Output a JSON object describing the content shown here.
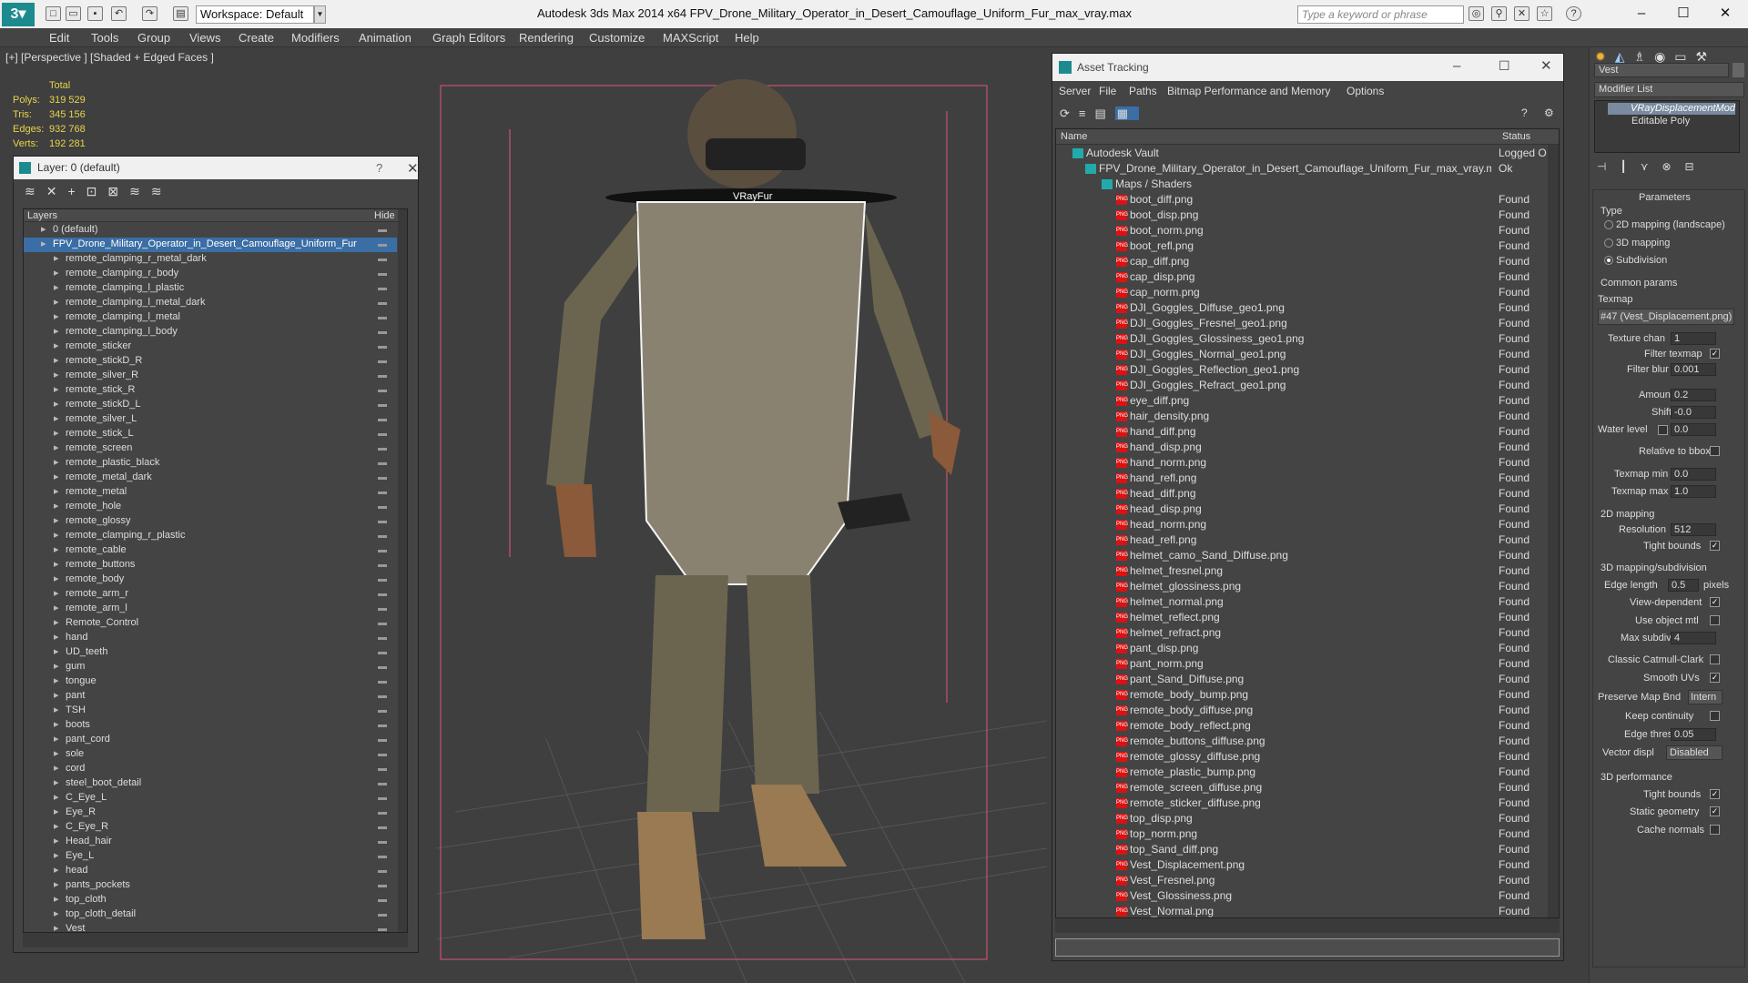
{
  "titlebar": {
    "workspace": "Workspace: Default",
    "title": "Autodesk 3ds Max  2014 x64      FPV_Drone_Military_Operator_in_Desert_Camouflage_Uniform_Fur_max_vray.max",
    "search_placeholder": "Type a keyword or phrase",
    "win_min": "–",
    "win_max": "☐",
    "win_close": "✕"
  },
  "menu": [
    "Edit",
    "Tools",
    "Group",
    "Views",
    "Create",
    "Modifiers",
    "Animation",
    "Graph Editors",
    "Rendering",
    "Customize",
    "MAXScript",
    "Help"
  ],
  "viewport": {
    "label": "[+] [Perspective ] [Shaded + Edged Faces ]",
    "stats": {
      "total": "Total",
      "polys_l": "Polys:",
      "polys": "319 529",
      "tris_l": "Tris:",
      "tris": "345 156",
      "edges_l": "Edges:",
      "edges": "932 768",
      "verts_l": "Verts:",
      "verts": "192 281"
    },
    "fur_label": "VRayFur",
    "accent": "#e05577"
  },
  "layer": {
    "title": "Layer: 0 (default)",
    "help": "?",
    "close": "✕",
    "col_layers": "Layers",
    "col_hide": "Hide",
    "default_layer": "0 (default)",
    "file_layer": "FPV_Drone_Military_Operator_in_Desert_Camouflage_Uniform_Fur",
    "items": [
      "remote_clamping_r_metal_dark",
      "remote_clamping_r_body",
      "remote_clamping_l_plastic",
      "remote_clamping_l_metal_dark",
      "remote_clamping_l_metal",
      "remote_clamping_l_body",
      "remote_sticker",
      "remote_stickD_R",
      "remote_silver_R",
      "remote_stick_R",
      "remote_stickD_L",
      "remote_silver_L",
      "remote_stick_L",
      "remote_screen",
      "remote_plastic_black",
      "remote_metal_dark",
      "remote_metal",
      "remote_hole",
      "remote_glossy",
      "remote_clamping_r_plastic",
      "remote_cable",
      "remote_buttons",
      "remote_body",
      "remote_arm_r",
      "remote_arm_l",
      "Remote_Control",
      "hand",
      "UD_teeth",
      "gum",
      "tongue",
      "pant",
      "TSH",
      "boots",
      "pant_cord",
      "sole",
      "cord",
      "steel_boot_detail",
      "C_Eye_L",
      "Eye_R",
      "C_Eye_R",
      "Head_hair",
      "Eye_L",
      "head",
      "pants_pockets",
      "top_cloth",
      "top_cloth_detail",
      "Vest"
    ]
  },
  "assets": {
    "title": "Asset Tracking",
    "menu": [
      "Server",
      "File",
      "Paths",
      "Bitmap Performance and Memory",
      "Options"
    ],
    "col_name": "Name",
    "col_status": "Status",
    "vault": "Autodesk Vault",
    "vault_status": "Logged O",
    "file": "FPV_Drone_Military_Operator_in_Desert_Camouflage_Uniform_Fur_max_vray.max",
    "file_status": "Ok",
    "maps": "Maps / Shaders",
    "files": [
      "boot_diff.png",
      "boot_disp.png",
      "boot_norm.png",
      "boot_refl.png",
      "cap_diff.png",
      "cap_disp.png",
      "cap_norm.png",
      "DJI_Goggles_Diffuse_geo1.png",
      "DJI_Goggles_Fresnel_geo1.png",
      "DJI_Goggles_Glossiness_geo1.png",
      "DJI_Goggles_Normal_geo1.png",
      "DJI_Goggles_Reflection_geo1.png",
      "DJI_Goggles_Refract_geo1.png",
      "eye_diff.png",
      "hair_density.png",
      "hand_diff.png",
      "hand_disp.png",
      "hand_norm.png",
      "hand_refl.png",
      "head_diff.png",
      "head_disp.png",
      "head_norm.png",
      "head_refl.png",
      "helmet_camo_Sand_Diffuse.png",
      "helmet_fresnel.png",
      "helmet_glossiness.png",
      "helmet_normal.png",
      "helmet_reflect.png",
      "helmet_refract.png",
      "pant_disp.png",
      "pant_norm.png",
      "pant_Sand_Diffuse.png",
      "remote_body_bump.png",
      "remote_body_diffuse.png",
      "remote_body_reflect.png",
      "remote_buttons_diffuse.png",
      "remote_glossy_diffuse.png",
      "remote_plastic_bump.png",
      "remote_screen_diffuse.png",
      "remote_sticker_diffuse.png",
      "top_disp.png",
      "top_norm.png",
      "top_Sand_diff.png",
      "Vest_Displacement.png",
      "Vest_Fresnel.png",
      "Vest_Glossiness.png",
      "Vest_Normal.png"
    ],
    "found": "Found"
  },
  "cmd": {
    "object_name": "Vest",
    "modifier_list": "Modifier List",
    "stack": [
      "VRayDisplacementMod",
      "Editable Poly"
    ],
    "params": "Parameters",
    "type": "Type",
    "type_opts": [
      "2D mapping (landscape)",
      "3D mapping",
      "Subdivision"
    ],
    "common": "Common params",
    "texmap": "Texmap",
    "texmap_val": "#47 (Vest_Displacement.png)",
    "fields": [
      {
        "l": "Texture chan",
        "v": "1"
      },
      {
        "l": "Filter blur",
        "v": "0.001"
      },
      {
        "l": "Amount",
        "v": "0.2"
      },
      {
        "l": "Shift",
        "v": "-0.0"
      },
      {
        "l": "Water level",
        "v": "0.0"
      },
      {
        "l": "Texmap min",
        "v": "0.0"
      },
      {
        "l": "Texmap max",
        "v": "1.0"
      }
    ],
    "filter_texmap": "Filter texmap",
    "relative_bbox": "Relative to bbox",
    "mapping2d": "2D mapping",
    "resolution": "Resolution",
    "resolution_val": "512",
    "tight_bounds": "Tight bounds",
    "mapping3d": "3D mapping/subdivision",
    "edge_length": "Edge length",
    "edge_length_val": "0.5",
    "pixels": "pixels",
    "view_dep": "View-dependent",
    "use_obj": "Use object mtl",
    "max_subdivs": "Max subdivs",
    "max_subdivs_val": "4",
    "catmull": "Classic Catmull-Clark",
    "smooth_uvs": "Smooth UVs",
    "preserve": "Preserve Map Bnd",
    "preserve_val": "Intern",
    "keep_cont": "Keep continuity",
    "edge_thresh": "Edge thresh",
    "edge_thresh_val": "0.05",
    "vector_displ": "Vector displ",
    "vector_displ_val": "Disabled",
    "perf": "3D performance",
    "tight_bounds2": "Tight bounds",
    "static_geo": "Static geometry",
    "cache_normals": "Cache normals"
  }
}
